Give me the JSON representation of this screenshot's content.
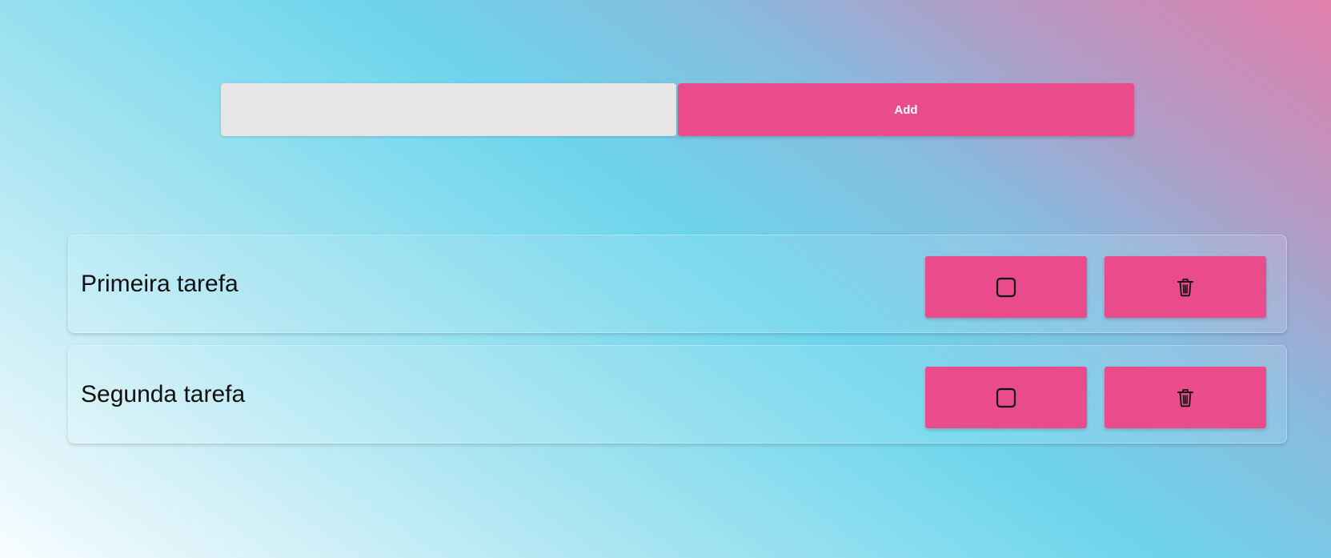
{
  "add_form": {
    "input_value": "",
    "input_placeholder": "",
    "add_label": "Add"
  },
  "tasks": [
    {
      "label": "Primeira tarefa",
      "completed": false,
      "complete_icon": "checkbox-unchecked-icon",
      "delete_icon": "trash-icon"
    },
    {
      "label": "Segunda tarefa",
      "completed": false,
      "complete_icon": "checkbox-unchecked-icon",
      "delete_icon": "trash-icon"
    }
  ],
  "colors": {
    "accent": "#ea4b8b",
    "input_bg": "#e6e6e6",
    "gradient_pink": "#e27fac",
    "gradient_cyan": "#6dd5ec",
    "gradient_white": "#f7fdff"
  }
}
